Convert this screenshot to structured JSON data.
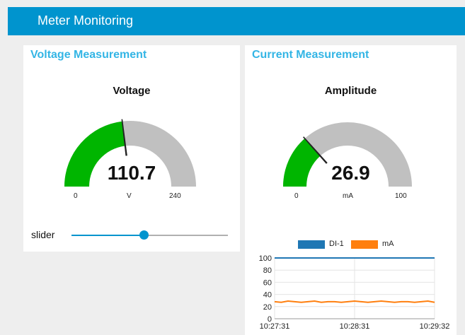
{
  "header": {
    "title": "Meter Monitoring"
  },
  "colors": {
    "header_bg": "#0094ce",
    "group_title": "#33b5e5",
    "gauge_fill": "#00b500",
    "gauge_bg": "#c0c0c0",
    "accent": "#0094ce",
    "series_di1": "#1f77b4",
    "series_ma": "#ff7f0e"
  },
  "voltage_group": {
    "title": "Voltage Measurement",
    "gauge": {
      "label": "Voltage",
      "value": "110.7",
      "value_num": 110.7,
      "unit": "V",
      "min": "0",
      "min_num": 0,
      "max": "240",
      "max_num": 240
    },
    "slider": {
      "label": "slider",
      "value_fraction": 0.46
    }
  },
  "current_group": {
    "title": "Current Measurement",
    "gauge": {
      "label": "Amplitude",
      "value": "26.9",
      "value_num": 26.9,
      "unit": "mA",
      "min": "0",
      "min_num": 0,
      "max": "100",
      "max_num": 100
    },
    "chart_data": {
      "type": "line",
      "legend": [
        "DI-1",
        "mA"
      ],
      "ylim": [
        0,
        100
      ],
      "y_ticks": [
        "100",
        "80",
        "60",
        "40",
        "20",
        "0"
      ],
      "x_ticks": [
        "10:27:31",
        "10:28:31",
        "10:29:32"
      ],
      "series": [
        {
          "name": "DI-1",
          "values": [
            100,
            100,
            100,
            100,
            100,
            100,
            100,
            100,
            100,
            100,
            100,
            100,
            100,
            100,
            100,
            100,
            100,
            100,
            100,
            100,
            100,
            100,
            100,
            100,
            100
          ]
        },
        {
          "name": "mA",
          "values": [
            28,
            27,
            29,
            28,
            27,
            28,
            29,
            27,
            28,
            28,
            27,
            28,
            29,
            28,
            27,
            28,
            29,
            28,
            27,
            28,
            28,
            27,
            28,
            29,
            27
          ]
        }
      ]
    }
  }
}
